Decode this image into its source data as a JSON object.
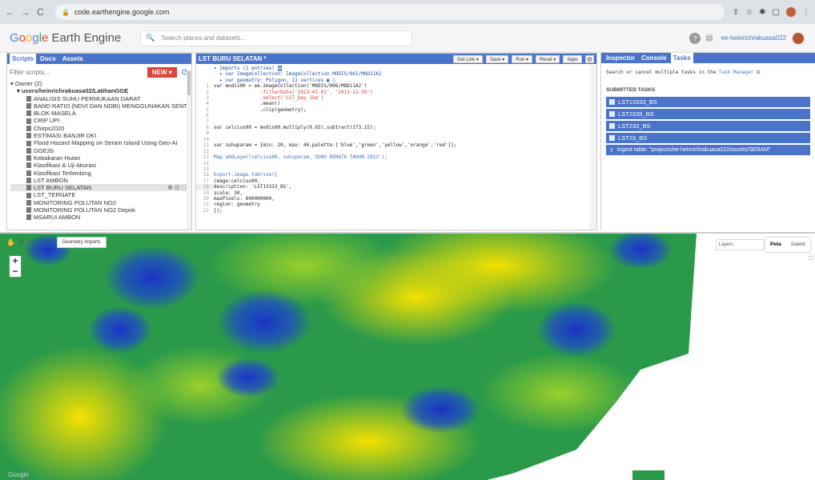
{
  "browser": {
    "url": "code.earthengine.google.com"
  },
  "header": {
    "logo_g": [
      "G",
      "o",
      "o",
      "g",
      "l",
      "e"
    ],
    "logo_rest": " Earth Engine",
    "search_placeholder": "Search places and datasets...",
    "user": "ee-heinrichrakuasa022"
  },
  "left": {
    "tabs": [
      "Scripts",
      "Docs",
      "Assets"
    ],
    "filter_placeholder": "Filter scripts...",
    "new_label": "NEW ▾",
    "owner": "▾ Owner (2)",
    "user_folder": "▾ users/heinrichrakuasa02/LatihanGGE",
    "files": [
      "ANALISIS SUHU PERMUKAAN DARAT",
      "BAND RATIO (NDVI DAN NDBI) MENGGUNAKAN SENTI...",
      "BLOK-MASELA",
      "CRIP UPI",
      "Chirps2020",
      "ESTIMASI BANJIR DKI",
      "Flood Hazard Mapping on Seram Island Using Geo-AI",
      "GGE2b",
      "Kebakaran Hutan",
      "Klasifikasi & Uji Akurasi",
      "Klasifikasi Terbimbing",
      "LST AMBON",
      "LST BURU SELATAN",
      "LST_TERNATE",
      "MONITORING POLUTAN NO2",
      "MONITORING POLUTAN NO2 Depok",
      "MSARUI AMBON"
    ]
  },
  "editor": {
    "title": "LST BURU SELATAN *",
    "buttons": [
      "Get Link ▾",
      "Save ▾",
      "Run ▾",
      "Reset ▾",
      "Apps"
    ],
    "imports_line": "Imports (2 entries)",
    "import1": "var ImageCollection: ImageCollection MODIS/061/MOD11A2",
    "import2": "var geometry: Polygon, 11 vertices",
    "lines": [
      "var modis00 = ee.ImageCollection('MODIS/006/MOD11A2')",
      "                .filterDate('2013-01-01', '2013-12-30')",
      "                .select('LST_Day_1km')",
      "                .mean()",
      "                .clip(geometry);",
      "",
      "",
      "var celcius00 = modis00.multiply(0.02).subtract(273.15);",
      "",
      "",
      "var suhuparam = {min: 20, max: 40,palette:['blue','green','yellow','orange','red']};",
      "",
      "Map.addLayer(celcius00, suhuparam,'SUHU RERATA TAHUN 2023');",
      "",
      "",
      "Export.image.toDrive({",
      "image:celcius00,",
      "description: 'LST13333_BS',",
      "scale: 30,",
      "maxPixels: 600000000,",
      "region: geometry",
      "});"
    ]
  },
  "right": {
    "tabs": [
      "Inspector",
      "Console",
      "Tasks"
    ],
    "hint": "Search or cancel multiple tasks in the ",
    "hint_link": "Task Manager",
    "submitted": "SUBMITTED TASKS",
    "tasks": [
      "LST13333_BS",
      "LST2335_BS",
      "LST233_BS",
      "LST23_BS",
      "Ingest table: \"projects/ee-heinrichrakuasa022/assets/SERAM\""
    ]
  },
  "map": {
    "geometry_imports": "Geometry Imports",
    "layers": "Layers",
    "map_types": [
      "Peta",
      "Satelit"
    ],
    "google": "Google",
    "zoom_in": "+",
    "zoom_out": "−"
  }
}
